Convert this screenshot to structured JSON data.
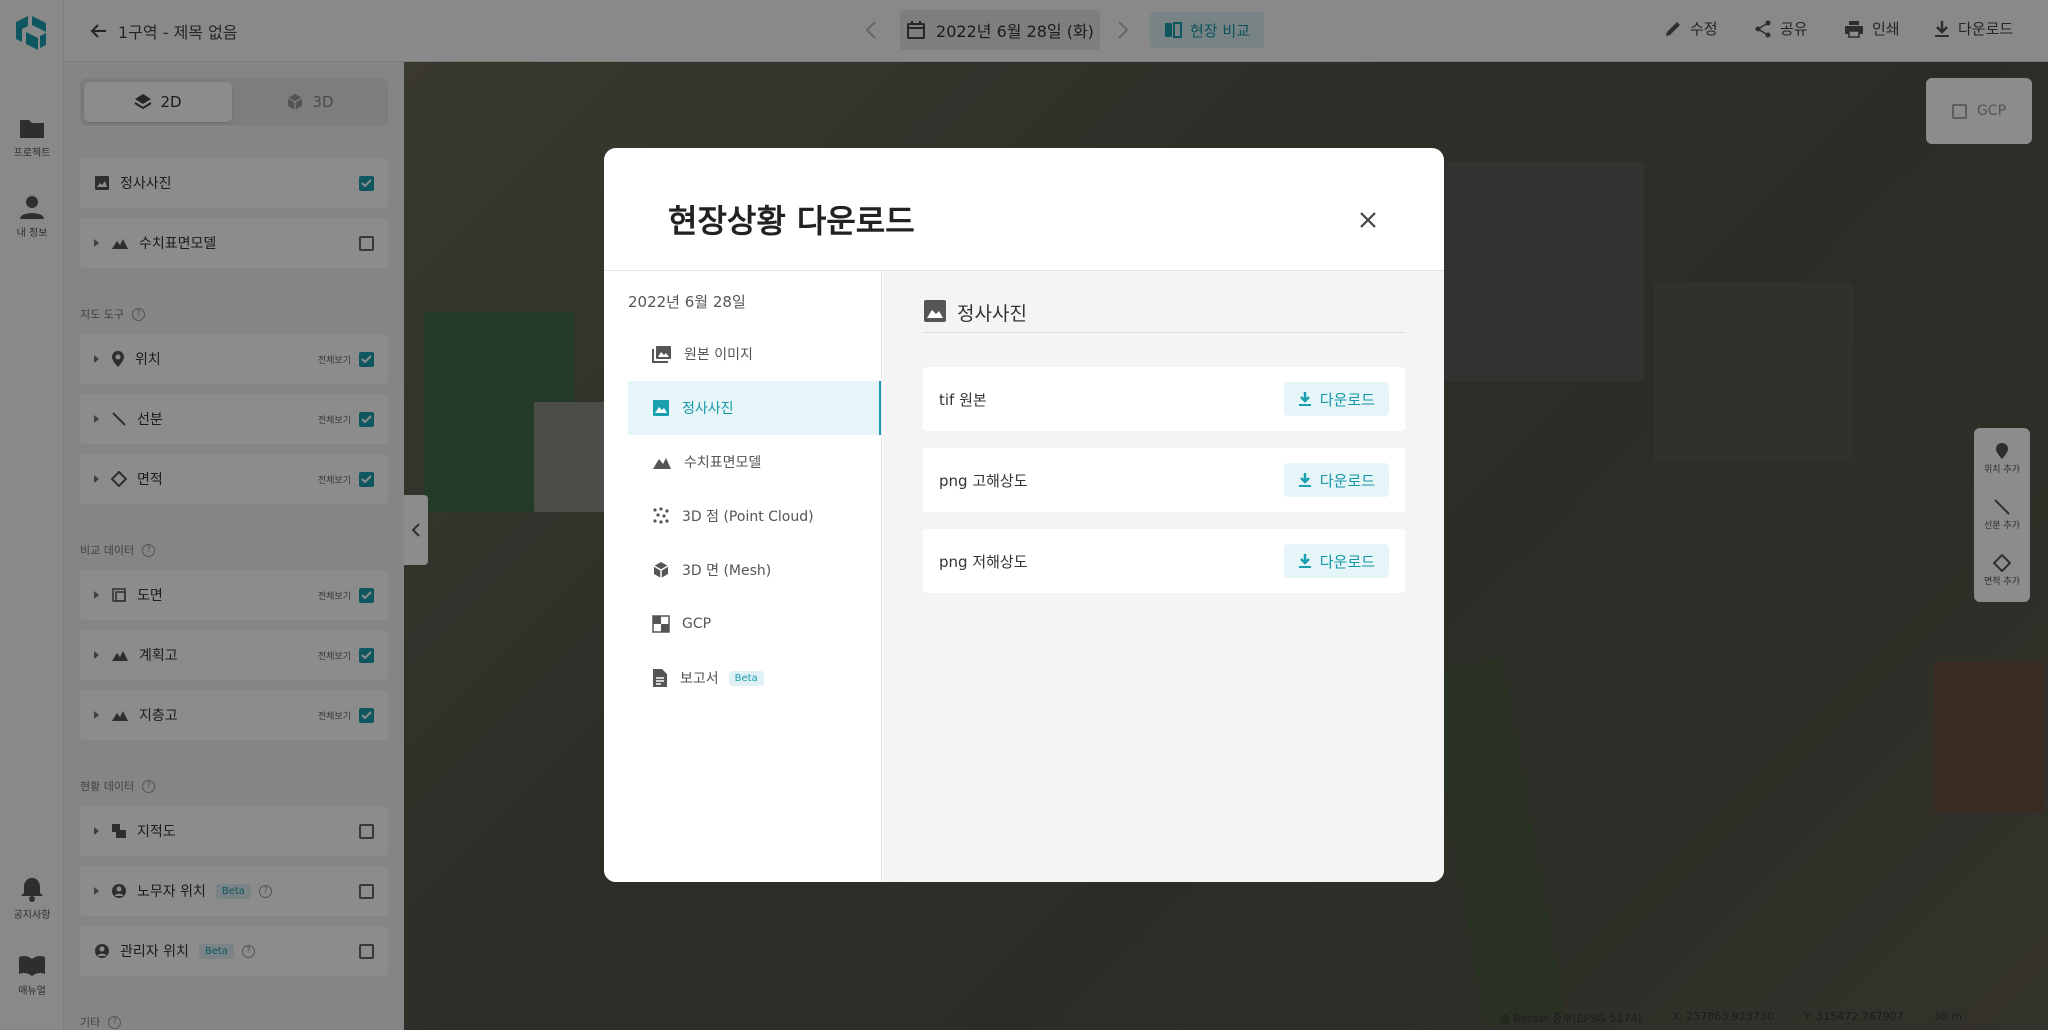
{
  "rail": {
    "items": [
      {
        "label": "프로젝트"
      },
      {
        "label": "내 정보"
      },
      {
        "label": "공지사항"
      },
      {
        "label": "매뉴얼"
      }
    ]
  },
  "topbar": {
    "back_title": "1구역 - 제목 없음",
    "date": "2022년 6월 28일 (화)",
    "compare": "현장 비교",
    "actions": {
      "edit": "수정",
      "share": "공유",
      "print": "인쇄",
      "download": "다운로드"
    }
  },
  "panel": {
    "mode_2d": "2D",
    "mode_3d": "3D",
    "layers_top": [
      {
        "label": "정사사진",
        "checked": true
      },
      {
        "label": "수치표면모델",
        "checked": false
      }
    ],
    "section_map_tools": "지도 도구",
    "map_tools": [
      {
        "label": "위치",
        "all": "전체보기"
      },
      {
        "label": "선분",
        "all": "전체보기"
      },
      {
        "label": "면적",
        "all": "전체보기"
      }
    ],
    "section_compare": "비교 데이터",
    "compare": [
      {
        "label": "도면",
        "all": "전체보기"
      },
      {
        "label": "계획고",
        "all": "전체보기"
      },
      {
        "label": "지층고",
        "all": "전체보기"
      }
    ],
    "section_site": "현황 데이터",
    "site": [
      {
        "label": "지적도"
      },
      {
        "label": "노무자 위치",
        "beta": "Beta"
      },
      {
        "label": "관리자 위치",
        "beta": "Beta"
      }
    ],
    "section_other": "기타"
  },
  "map": {
    "gcp_label": "GCP",
    "tools": [
      {
        "label": "위치 추가"
      },
      {
        "label": "선분 추가"
      },
      {
        "label": "면적 추가"
      }
    ],
    "status": {
      "crs": "Bessel 중부(EPSG 5174)",
      "x": "X: 237863.923730",
      "y": "Y: 315472.767907",
      "scale": "30 m"
    }
  },
  "modal": {
    "title": "현장상황 다운로드",
    "date": "2022년 6월 28일",
    "nav": [
      {
        "label": "원본 이미지",
        "icon": "images-icon"
      },
      {
        "label": "정사사진",
        "icon": "image-icon",
        "active": true
      },
      {
        "label": "수치표면모델",
        "icon": "terrain-icon"
      },
      {
        "label": "3D 점 (Point Cloud)",
        "icon": "point-cloud-icon"
      },
      {
        "label": "3D 면 (Mesh)",
        "icon": "cube-icon"
      },
      {
        "label": "GCP",
        "icon": "gcp-icon"
      },
      {
        "label": "보고서",
        "icon": "document-icon",
        "beta": "Beta"
      }
    ],
    "section_title": "정사사진",
    "files": [
      {
        "label": "tif 원본",
        "button": "다운로드"
      },
      {
        "label": "png 고해상도",
        "button": "다운로드"
      },
      {
        "label": "png 저해상도",
        "button": "다운로드"
      }
    ]
  },
  "colors": {
    "accent": "#1a9fb0",
    "accent_light": "#e6f5f8"
  }
}
